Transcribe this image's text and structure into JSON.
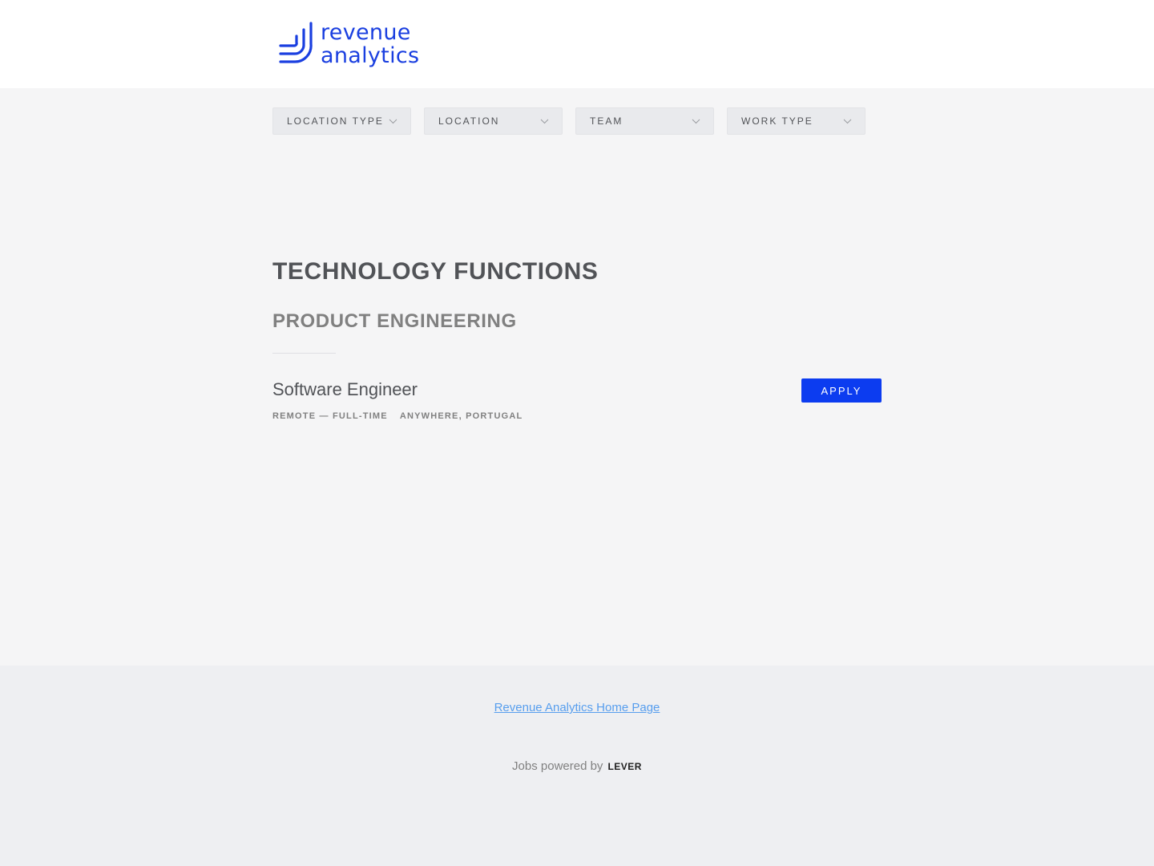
{
  "header": {
    "logo": {
      "icon": "revenue-analytics-logo-icon",
      "line1": "revenue",
      "line2": "analytics",
      "color": "#1a3fe0"
    }
  },
  "filters": [
    {
      "label": "LOCATION TYPE",
      "icon": "chevron-down-icon"
    },
    {
      "label": "LOCATION",
      "icon": "chevron-down-icon"
    },
    {
      "label": "TEAM",
      "icon": "chevron-down-icon"
    },
    {
      "label": "WORK TYPE",
      "icon": "chevron-down-icon"
    }
  ],
  "main": {
    "department": "TECHNOLOGY FUNCTIONS",
    "team": "PRODUCT ENGINEERING",
    "postings": [
      {
        "title": "Software Engineer",
        "commitment": "REMOTE — FULL-TIME",
        "location": "ANYWHERE, PORTUGAL",
        "apply_label": "APPLY"
      }
    ]
  },
  "footer": {
    "home_link": "Revenue Analytics Home Page",
    "powered_by": "Jobs powered by",
    "brand": "LEVER"
  },
  "colors": {
    "apply_button": "#0c3cf0",
    "link": "#579eee",
    "brand": "#1a3fe0"
  }
}
